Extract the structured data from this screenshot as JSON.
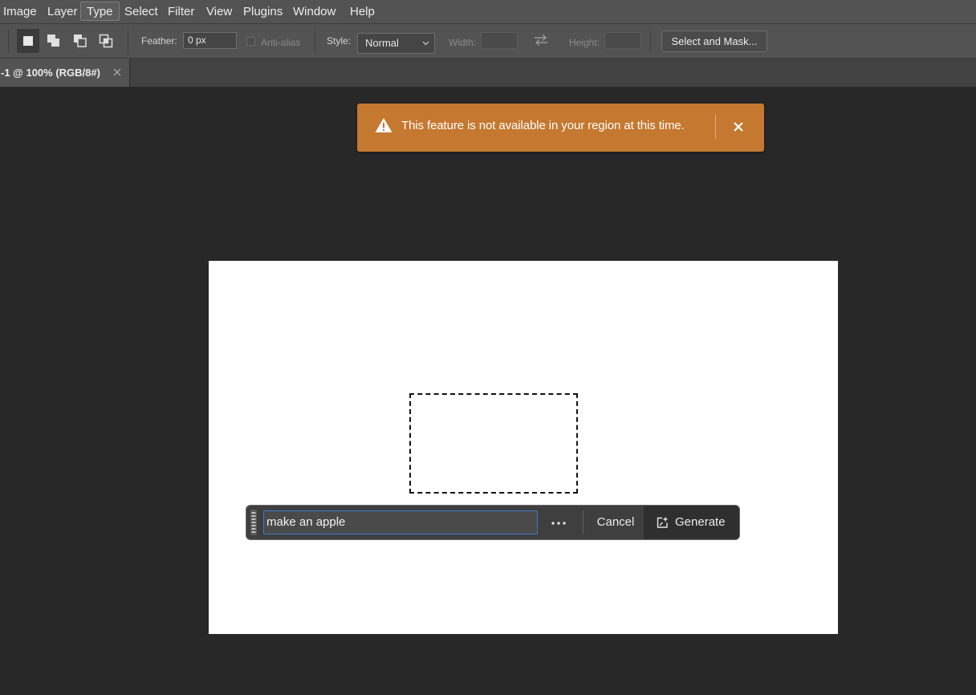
{
  "menu": {
    "items": [
      "Image",
      "Layer",
      "Type",
      "Select",
      "Filter",
      "View",
      "Plugins",
      "Window",
      "Help"
    ],
    "active": "Type"
  },
  "options": {
    "feather_label": "Feather:",
    "feather_value": "0 px",
    "antialias_label": "Anti-alias",
    "style_label": "Style:",
    "style_value": "Normal",
    "width_label": "Width:",
    "height_label": "Height:",
    "select_mask_label": "Select and Mask..."
  },
  "document_tab": {
    "label": "-1 @ 100% (RGB/8#)"
  },
  "banner": {
    "message": "This feature is not available in your region at this time.",
    "color": "#c5782f"
  },
  "contextual_bar": {
    "prompt_value": "make an apple",
    "cancel_label": "Cancel",
    "generate_label": "Generate"
  }
}
